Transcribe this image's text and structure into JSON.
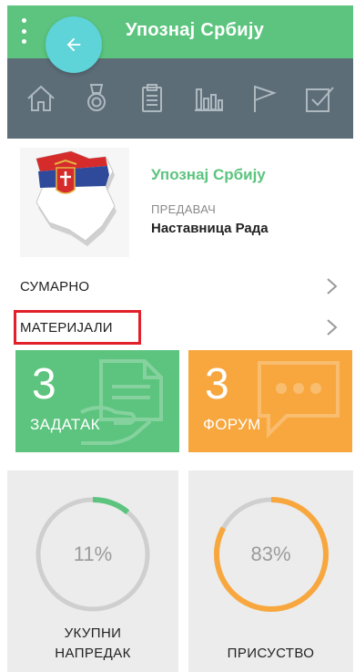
{
  "app": {
    "title": "Упознај Србију"
  },
  "icons": {
    "menu": "more-vert-icon",
    "back": "arrow-left-icon",
    "nav": [
      "home-icon",
      "medal-icon",
      "clipboard-icon",
      "bar-chart-icon",
      "flag-icon",
      "checkbox-icon"
    ]
  },
  "course": {
    "title": "Упознај Србију",
    "lecturer_label": "ПРЕДАВАЧ",
    "lecturer_name": "Наставница Рада"
  },
  "menu": {
    "summary_label": "СУМАРНО",
    "materials_label": "МАТЕРИЈАЛИ"
  },
  "tiles": {
    "assignment": {
      "count": "3",
      "label": "ЗАДАТАК"
    },
    "forum": {
      "count": "3",
      "label": "ФОРУМ"
    }
  },
  "stats": {
    "progress": {
      "value": "11%",
      "fraction": 0.11,
      "label_line1": "УКУПНИ",
      "label_line2": "НАПРЕДАК"
    },
    "attendance": {
      "value": "83%",
      "fraction": 0.83,
      "label": "ПРИСУСТВО"
    }
  },
  "colors": {
    "primary_green": "#5cc47e",
    "accent_cyan": "#5ed3d8",
    "slate": "#5c6d78",
    "orange": "#f7a73e",
    "highlight_red": "#e2202a",
    "ring_track": "#cfcfcf",
    "ring_progress_green": "#5cc47e",
    "ring_progress_orange": "#f7a73e"
  }
}
